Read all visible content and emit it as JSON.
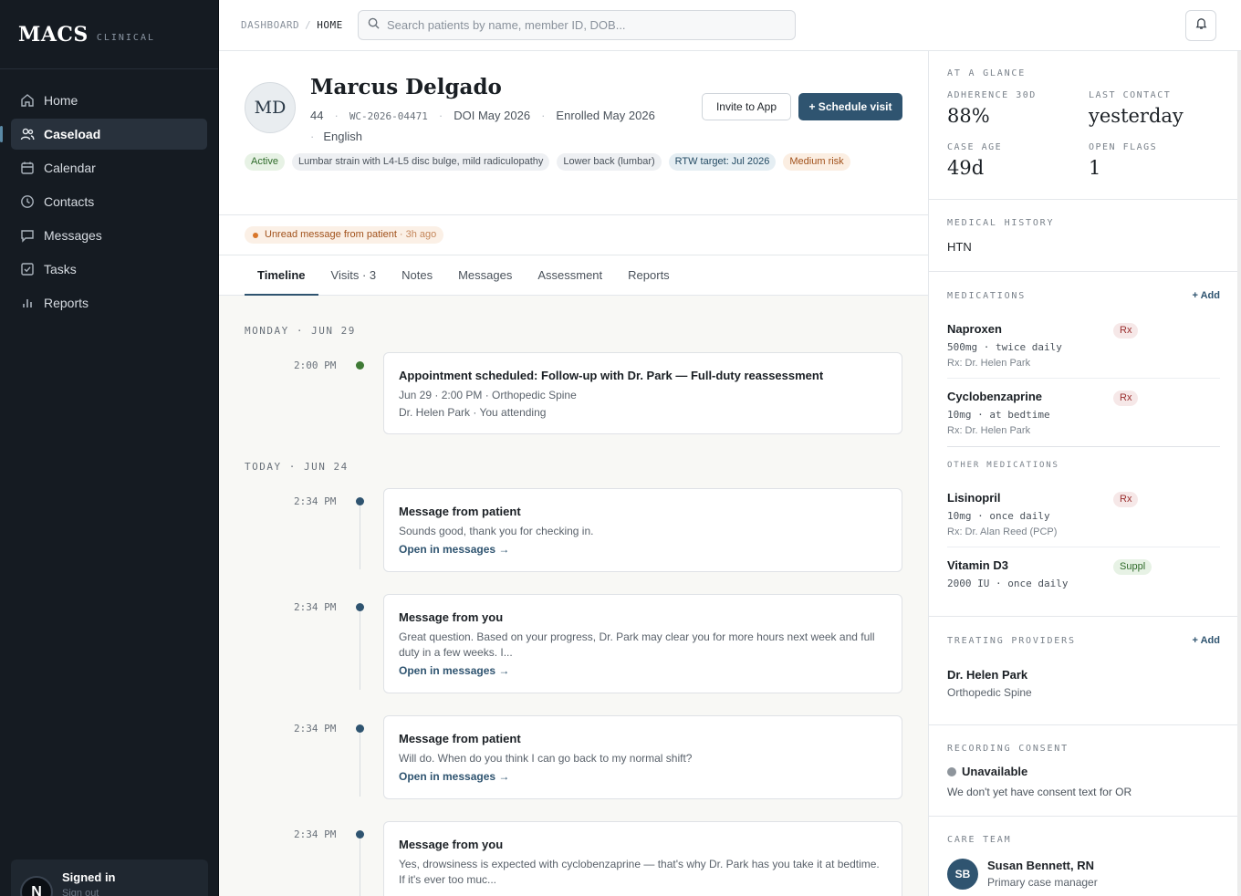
{
  "app": {
    "brand": "MACS",
    "brand_sub": "CLINICAL"
  },
  "sidebar": {
    "items": [
      {
        "label": "Home",
        "icon": "home-icon"
      },
      {
        "label": "Caseload",
        "icon": "users-icon",
        "active": true
      },
      {
        "label": "Calendar",
        "icon": "calendar-icon"
      },
      {
        "label": "Contacts",
        "icon": "contacts-icon"
      },
      {
        "label": "Messages",
        "icon": "message-icon"
      },
      {
        "label": "Tasks",
        "icon": "checkbox-icon"
      },
      {
        "label": "Reports",
        "icon": "bar-chart-icon"
      }
    ],
    "user": {
      "initial": "N",
      "title": "Signed in",
      "sub": "Sign out"
    }
  },
  "topbar": {
    "crumbs": [
      "DASHBOARD",
      "HOME"
    ],
    "search_placeholder": "Search patients by name, member ID, DOB..."
  },
  "patient": {
    "initials": "MD",
    "name": "Marcus Delgado",
    "age": "44",
    "member_id": "WC-2026-04471",
    "doi": "DOI May 2026",
    "enrolled": "Enrolled May 2026",
    "language": "English",
    "invite_label": "Invite to App",
    "schedule_label": "+ Schedule visit",
    "chips": [
      {
        "label": "Active",
        "tone": "green"
      },
      {
        "label": "Lumbar strain with L4-L5 disc bulge, mild radiculopathy",
        "tone": "gray"
      },
      {
        "label": "Lower back (lumbar)",
        "tone": "gray"
      },
      {
        "label": "RTW target: Jul 2026",
        "tone": "teal"
      },
      {
        "label": "Medium risk",
        "tone": "orange"
      }
    ]
  },
  "alert": {
    "text": "Unread message from patient",
    "ago": "· 3h ago"
  },
  "tabs": [
    "Timeline",
    "Visits · 3",
    "Notes",
    "Messages",
    "Assessment",
    "Reports"
  ],
  "timeline": {
    "days": [
      "MONDAY · JUN 29",
      "TODAY · JUN 24"
    ],
    "events": [
      {
        "time": "2:00 PM",
        "title": "Appointment scheduled: Follow-up with Dr. Park — Full-duty reassessment",
        "line1": "Jun 29 · 2:00 PM · Orthopedic Spine",
        "line2": "Dr. Helen Park · You attending"
      },
      {
        "time": "2:34 PM",
        "title": "Message from patient",
        "body": "Sounds good, thank you for checking in.",
        "link": "Open in messages →"
      },
      {
        "time": "2:34 PM",
        "title": "Message from you",
        "body": "Great question. Based on your progress, Dr. Park may clear you for more hours next week and full duty in a few weeks. I...",
        "link": "Open in messages →"
      },
      {
        "time": "2:34 PM",
        "title": "Message from patient",
        "body": "Will do. When do you think I can go back to my normal shift?",
        "link": "Open in messages →"
      },
      {
        "time": "2:34 PM",
        "title": "Message from you",
        "body": "Yes, drowsiness is expected with cyclobenzaprine — that's why Dr. Park has you take it at bedtime. If it's ever too muc..."
      }
    ]
  },
  "glance": {
    "label": "AT A GLANCE",
    "stats": [
      {
        "label": "ADHERENCE 30D",
        "value": "88%"
      },
      {
        "label": "LAST CONTACT",
        "value": "yesterday"
      },
      {
        "label": "CASE AGE",
        "value": "49d"
      },
      {
        "label": "OPEN FLAGS",
        "value": "1"
      }
    ]
  },
  "history": {
    "label": "MEDICAL HISTORY",
    "value": "HTN"
  },
  "medications": {
    "label": "MEDICATIONS",
    "add": "+ Add",
    "items": [
      {
        "name": "Naproxen",
        "dose": "500mg · twice daily",
        "rx": "Rx: Dr. Helen Park",
        "badge": "Rx"
      },
      {
        "name": "Cyclobenzaprine",
        "dose": "10mg · at bedtime",
        "rx": "Rx: Dr. Helen Park",
        "badge": "Rx"
      }
    ],
    "other_label": "OTHER MEDICATIONS",
    "other": [
      {
        "name": "Lisinopril",
        "dose": "10mg · once daily",
        "rx": "Rx: Dr. Alan Reed (PCP)",
        "badge": "Rx"
      },
      {
        "name": "Vitamin D3",
        "dose": "2000 IU · once daily",
        "badge": "Suppl"
      }
    ]
  },
  "providers": {
    "label": "TREATING PROVIDERS",
    "add": "+ Add",
    "items": [
      {
        "name": "Dr. Helen Park",
        "specialty": "Orthopedic Spine"
      }
    ]
  },
  "consent": {
    "label": "RECORDING CONSENT",
    "status": "Unavailable",
    "note": "We don't yet have consent text for OR"
  },
  "care_team": {
    "label": "CARE TEAM",
    "members": [
      {
        "initials": "SB",
        "name": "Susan Bennett, RN",
        "role": "Primary case manager"
      }
    ]
  },
  "colors": {
    "accent": "#2f5470",
    "sidebar_bg": "#151b22",
    "alert": "#d9762a",
    "rx_badge": "#9a2f2f"
  }
}
